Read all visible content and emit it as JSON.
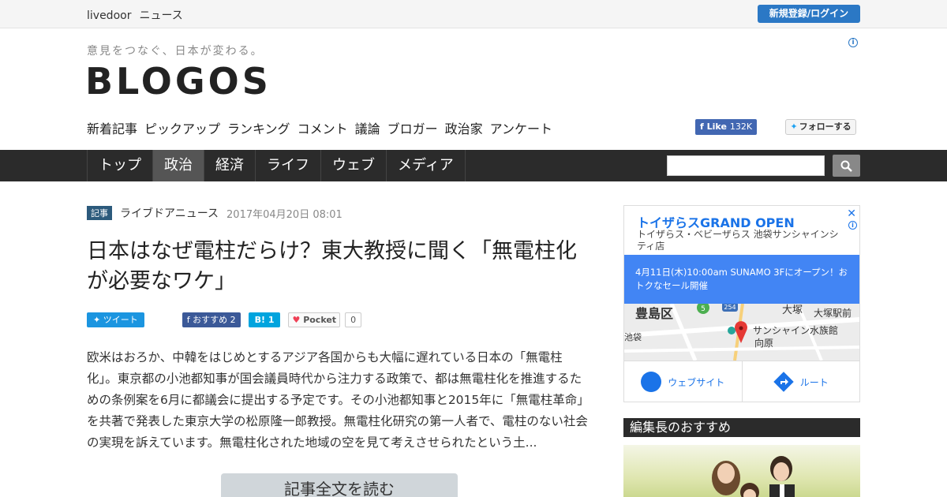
{
  "topbar": {
    "brand_a": "livedoor",
    "brand_b": "ニュース",
    "login": "新規登録/ログイン"
  },
  "header": {
    "tagline": "意見をつなぐ、日本が変わる。",
    "logo": "BLOGOS",
    "info": "i",
    "subnav": [
      "新着記事",
      "ピックアップ",
      "ランキング",
      "コメント",
      "議論",
      "ブロガー",
      "政治家",
      "アンケート"
    ],
    "fb_like": "Like",
    "fb_count": "132K",
    "tw_follow": "フォローする"
  },
  "mainnav": {
    "items": [
      "トップ",
      "政治",
      "経済",
      "ライフ",
      "ウェブ",
      "メディア"
    ],
    "active": "政治"
  },
  "article": {
    "tag": "記事",
    "source": "ライブドアニュース",
    "date": "2017年04月20日 08:01",
    "title": "日本はなぜ電柱だらけ？東大教授に聞く「無電柱化が必要なワケ」",
    "share": {
      "tweet": "ツイート",
      "fb": "おすすめ 2",
      "hatena": "B! 1",
      "pocket": "Pocket",
      "pocket_count": "0"
    },
    "body": "欧米はおろか、中韓をはじめとするアジア各国からも大幅に遅れている日本の「無電柱化」。東京都の小池都知事が国会議員時代から注力する政策で、都は無電柱化を推進するための条例案を6月に都議会に提出する予定です。その小池都知事と2015年に「無電柱革命」を共著で発表した東京大学の松原隆一郎教授。無電柱化研究の第一人者で、電柱のない社会の実現を訴えています。無電柱化された地域の空を見て考えさせられたという土...",
    "read_more": "記事全文を読む"
  },
  "ad": {
    "title": "トイザらスGRAND OPEN",
    "subtitle": "トイザらス・ベビーザらス 池袋サンシャインシティ店",
    "close": "✕",
    "info": "i",
    "banner": "4月11日(木)10:00am SUNAMO 3Fにオープン！おトクなセール開催",
    "map": {
      "ward": "豊島区",
      "label_a": "大塚",
      "label_b": "大塚駅前",
      "label_c": "サンシャイン水族館",
      "label_d": "向原",
      "label_e": "池袋",
      "route_254": "254",
      "route_5": "5"
    },
    "website": "ウェブサイト",
    "route": "ルート"
  },
  "sidebar": {
    "editor_head": "編集長のおすすめ"
  }
}
